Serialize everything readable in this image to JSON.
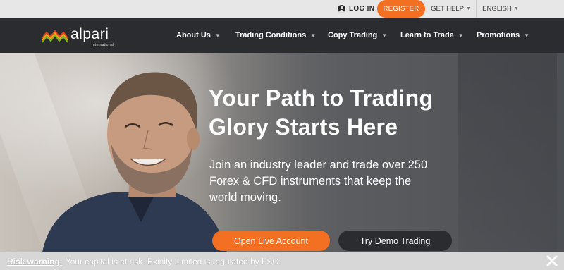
{
  "topbar": {
    "login_label": "LOG IN",
    "register_label": "REGISTER",
    "get_help_label": "GET HELP",
    "language_label": "ENGLISH"
  },
  "brand": {
    "name": "alpari",
    "tagline": "International",
    "accent_color": "#f36f21"
  },
  "nav": {
    "items": [
      {
        "label": "About Us"
      },
      {
        "label": "Trading Conditions"
      },
      {
        "label": "Copy Trading"
      },
      {
        "label": "Learn to Trade"
      },
      {
        "label": "Promotions"
      }
    ]
  },
  "hero": {
    "title_line1": "Your Path to Trading",
    "title_line2": "Glory Starts Here",
    "subtitle_line1": "Join an industry leader and trade over 250",
    "subtitle_line2": "Forex & CFD instruments that keep the",
    "subtitle_line3": "world moving.",
    "primary_cta": "Open Live Account",
    "secondary_cta": "Try Demo Trading"
  },
  "risk_warning": {
    "label": "Risk warning:",
    "text": "Your capital is at risk. Exinity Limited is regulated by FSC."
  },
  "icons": {
    "user": "user-icon",
    "close": "close-icon",
    "caret": "chevron-down-icon"
  }
}
